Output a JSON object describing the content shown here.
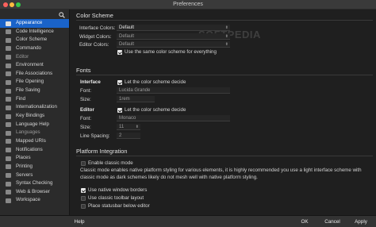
{
  "window": {
    "title": "Preferences"
  },
  "sidebar": {
    "items": [
      {
        "label": "Appearance",
        "icon": "appearance-icon"
      },
      {
        "label": "Code Intelligence",
        "icon": "code-intelligence-icon"
      },
      {
        "label": "Color Scheme",
        "icon": "color-scheme-icon"
      },
      {
        "label": "Commando",
        "icon": "commando-icon"
      },
      {
        "label": "Editor",
        "icon": "editor-icon"
      },
      {
        "label": "Environment",
        "icon": "environment-icon"
      },
      {
        "label": "File Associations",
        "icon": "file-associations-icon"
      },
      {
        "label": "File Opening",
        "icon": "file-opening-icon"
      },
      {
        "label": "File Saving",
        "icon": "file-saving-icon"
      },
      {
        "label": "Find",
        "icon": "find-icon"
      },
      {
        "label": "Internationalization",
        "icon": "internationalization-icon"
      },
      {
        "label": "Key Bindings",
        "icon": "key-bindings-icon"
      },
      {
        "label": "Language Help",
        "icon": "language-help-icon"
      },
      {
        "label": "Languages",
        "icon": "languages-icon"
      },
      {
        "label": "Mapped URIs",
        "icon": "mapped-uris-icon"
      },
      {
        "label": "Notifications",
        "icon": "notifications-icon"
      },
      {
        "label": "Places",
        "icon": "places-icon"
      },
      {
        "label": "Printing",
        "icon": "printing-icon"
      },
      {
        "label": "Servers",
        "icon": "servers-icon"
      },
      {
        "label": "Syntax Checking",
        "icon": "syntax-checking-icon"
      },
      {
        "label": "Web & Browser",
        "icon": "web-browser-icon"
      },
      {
        "label": "Workspace",
        "icon": "workspace-icon"
      }
    ]
  },
  "color_scheme": {
    "title": "Color Scheme",
    "interface_label": "Interface Colors:",
    "interface_value": "Default",
    "widget_label": "Widget Colors:",
    "widget_value": "Default",
    "editor_label": "Editor Colors:",
    "editor_value": "Default",
    "use_same_label": "Use the same color scheme for everything",
    "use_same_checked": true
  },
  "fonts": {
    "title": "Fonts",
    "interface_heading": "Interface",
    "interface_decide_label": "Let the color scheme decide",
    "interface_font_label": "Font:",
    "interface_font_value": "Lucida Grande",
    "interface_size_label": "Size:",
    "interface_size_value": "1rem",
    "editor_heading": "Editor",
    "editor_decide_label": "Let the color scheme decide",
    "editor_font_label": "Font:",
    "editor_font_value": "Monaco",
    "editor_size_label": "Size:",
    "editor_size_value": "11",
    "line_spacing_label": "Line Spacing:",
    "line_spacing_value": "2"
  },
  "platform": {
    "title": "Platform Integration",
    "classic_label": "Enable classic mode",
    "classic_desc": "Classic mode enables native platform styling for various elements, it is highly recommended you use a light interface scheme with classic mode as dark schemes likely do not mesh well with native platform styling.",
    "native_borders_label": "Use native window borders",
    "classic_toolbar_label": "Use classic toolbar layout",
    "statusbar_label": "Place statusbar below editor"
  },
  "footer": {
    "help_label": "Help",
    "ok_label": "OK",
    "cancel_label": "Cancel",
    "apply_label": "Apply"
  },
  "watermark": {
    "text": "SOFTPEDIA"
  }
}
